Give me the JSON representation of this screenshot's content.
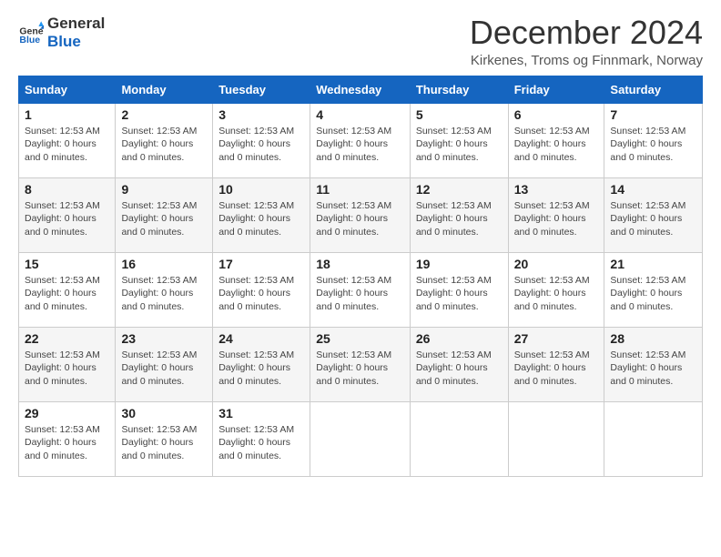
{
  "logo": {
    "line1": "General",
    "line2": "Blue",
    "icon_color": "#2196f3"
  },
  "title": "December 2024",
  "location": "Kirkenes, Troms og Finnmark, Norway",
  "days_of_week": [
    "Sunday",
    "Monday",
    "Tuesday",
    "Wednesday",
    "Thursday",
    "Friday",
    "Saturday"
  ],
  "default_info": "Sunset: 12:53 AM\nDaylight: 0 hours and 0 minutes.",
  "weeks": [
    [
      {
        "day": "1",
        "info": "Sunset: 12:53 AM\nDaylight: 0 hours\nand 0 minutes."
      },
      {
        "day": "2",
        "info": "Sunset: 12:53 AM\nDaylight: 0 hours\nand 0 minutes."
      },
      {
        "day": "3",
        "info": "Sunset: 12:53 AM\nDaylight: 0 hours\nand 0 minutes."
      },
      {
        "day": "4",
        "info": "Sunset: 12:53 AM\nDaylight: 0 hours\nand 0 minutes."
      },
      {
        "day": "5",
        "info": "Sunset: 12:53 AM\nDaylight: 0 hours\nand 0 minutes."
      },
      {
        "day": "6",
        "info": "Sunset: 12:53 AM\nDaylight: 0 hours\nand 0 minutes."
      },
      {
        "day": "7",
        "info": "Sunset: 12:53 AM\nDaylight: 0 hours\nand 0 minutes."
      }
    ],
    [
      {
        "day": "8",
        "info": "Sunset: 12:53 AM\nDaylight: 0 hours\nand 0 minutes."
      },
      {
        "day": "9",
        "info": "Sunset: 12:53 AM\nDaylight: 0 hours\nand 0 minutes."
      },
      {
        "day": "10",
        "info": "Sunset: 12:53 AM\nDaylight: 0 hours\nand 0 minutes."
      },
      {
        "day": "11",
        "info": "Sunset: 12:53 AM\nDaylight: 0 hours\nand 0 minutes."
      },
      {
        "day": "12",
        "info": "Sunset: 12:53 AM\nDaylight: 0 hours\nand 0 minutes."
      },
      {
        "day": "13",
        "info": "Sunset: 12:53 AM\nDaylight: 0 hours\nand 0 minutes."
      },
      {
        "day": "14",
        "info": "Sunset: 12:53 AM\nDaylight: 0 hours\nand 0 minutes."
      }
    ],
    [
      {
        "day": "15",
        "info": "Sunset: 12:53 AM\nDaylight: 0 hours\nand 0 minutes."
      },
      {
        "day": "16",
        "info": "Sunset: 12:53 AM\nDaylight: 0 hours\nand 0 minutes."
      },
      {
        "day": "17",
        "info": "Sunset: 12:53 AM\nDaylight: 0 hours\nand 0 minutes."
      },
      {
        "day": "18",
        "info": "Sunset: 12:53 AM\nDaylight: 0 hours\nand 0 minutes."
      },
      {
        "day": "19",
        "info": "Sunset: 12:53 AM\nDaylight: 0 hours\nand 0 minutes."
      },
      {
        "day": "20",
        "info": "Sunset: 12:53 AM\nDaylight: 0 hours\nand 0 minutes."
      },
      {
        "day": "21",
        "info": "Sunset: 12:53 AM\nDaylight: 0 hours\nand 0 minutes."
      }
    ],
    [
      {
        "day": "22",
        "info": "Sunset: 12:53 AM\nDaylight: 0 hours\nand 0 minutes."
      },
      {
        "day": "23",
        "info": "Sunset: 12:53 AM\nDaylight: 0 hours\nand 0 minutes."
      },
      {
        "day": "24",
        "info": "Sunset: 12:53 AM\nDaylight: 0 hours\nand 0 minutes."
      },
      {
        "day": "25",
        "info": "Sunset: 12:53 AM\nDaylight: 0 hours\nand 0 minutes."
      },
      {
        "day": "26",
        "info": "Sunset: 12:53 AM\nDaylight: 0 hours\nand 0 minutes."
      },
      {
        "day": "27",
        "info": "Sunset: 12:53 AM\nDaylight: 0 hours\nand 0 minutes."
      },
      {
        "day": "28",
        "info": "Sunset: 12:53 AM\nDaylight: 0 hours\nand 0 minutes."
      }
    ],
    [
      {
        "day": "29",
        "info": "Sunset: 12:53 AM\nDaylight: 0 hours\nand 0 minutes."
      },
      {
        "day": "30",
        "info": "Sunset: 12:53 AM\nDaylight: 0 hours\nand 0 minutes."
      },
      {
        "day": "31",
        "info": "Sunset: 12:53 AM\nDaylight: 0 hours\nand 0 minutes."
      },
      {
        "day": "",
        "info": ""
      },
      {
        "day": "",
        "info": ""
      },
      {
        "day": "",
        "info": ""
      },
      {
        "day": "",
        "info": ""
      }
    ]
  ]
}
